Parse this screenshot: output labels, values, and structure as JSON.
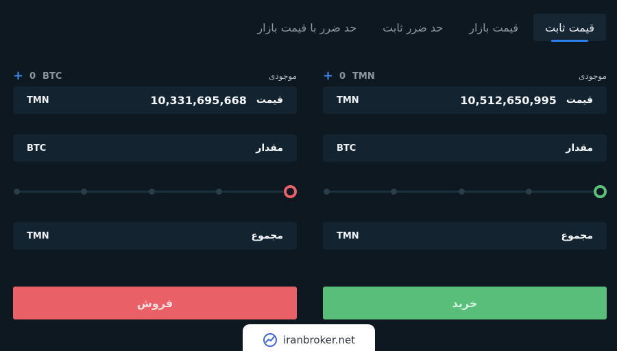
{
  "tabs": [
    {
      "label": "قیمت ثابت",
      "active": true
    },
    {
      "label": "قیمت بازار",
      "active": false
    },
    {
      "label": "حد ضرر ثابت",
      "active": false
    },
    {
      "label": "حد ضرر با قیمت بازار",
      "active": false
    }
  ],
  "colors": {
    "accent": "#2f7fe9",
    "buy": "#59be7a",
    "sell": "#e96166",
    "background": "#0d1821",
    "field": "#132330"
  },
  "buy": {
    "balance_label": "موجودی",
    "balance_value": "0",
    "balance_unit": "TMN",
    "price_label": "قیمت",
    "price_value": "10,512,650,995",
    "price_unit": "TMN",
    "amount_label": "مقدار",
    "amount_unit": "BTC",
    "slider_percent": 100,
    "total_label": "مجموع",
    "total_unit": "TMN",
    "button_label": "خرید"
  },
  "sell": {
    "balance_label": "موجودی",
    "balance_value": "0",
    "balance_unit": "BTC",
    "price_label": "قیمت",
    "price_value": "10,331,695,668",
    "price_unit": "TMN",
    "amount_label": "مقدار",
    "amount_unit": "BTC",
    "slider_percent": 100,
    "total_label": "مجموع",
    "total_unit": "TMN",
    "button_label": "فروش"
  },
  "watermark": {
    "text": "iranbroker.net",
    "icon": "chart-trend-icon"
  }
}
